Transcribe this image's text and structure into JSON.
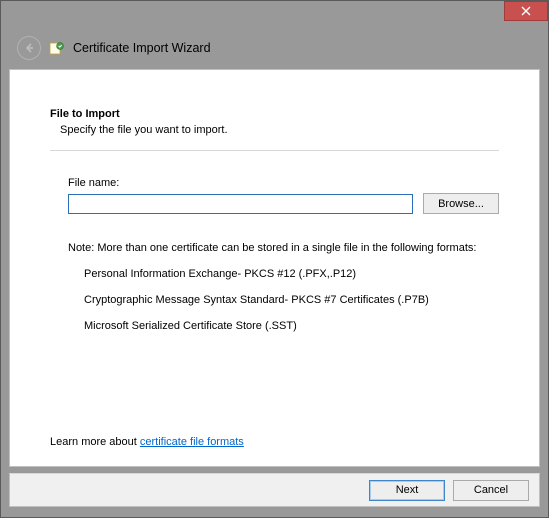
{
  "window": {
    "title": "Certificate Import Wizard"
  },
  "page": {
    "heading": "File to Import",
    "subtext": "Specify the file you want to import.",
    "file_label": "File name:",
    "file_value": "",
    "browse_label": "Browse...",
    "note": "Note:  More than one certificate can be stored in a single file in the following formats:",
    "formats": {
      "f1": "Personal Information Exchange- PKCS #12 (.PFX,.P12)",
      "f2": "Cryptographic Message Syntax Standard- PKCS #7 Certificates (.P7B)",
      "f3": "Microsoft Serialized Certificate Store (.SST)"
    },
    "learn_prefix": "Learn more about ",
    "learn_link": "certificate file formats"
  },
  "footer": {
    "next": "Next",
    "cancel": "Cancel"
  }
}
